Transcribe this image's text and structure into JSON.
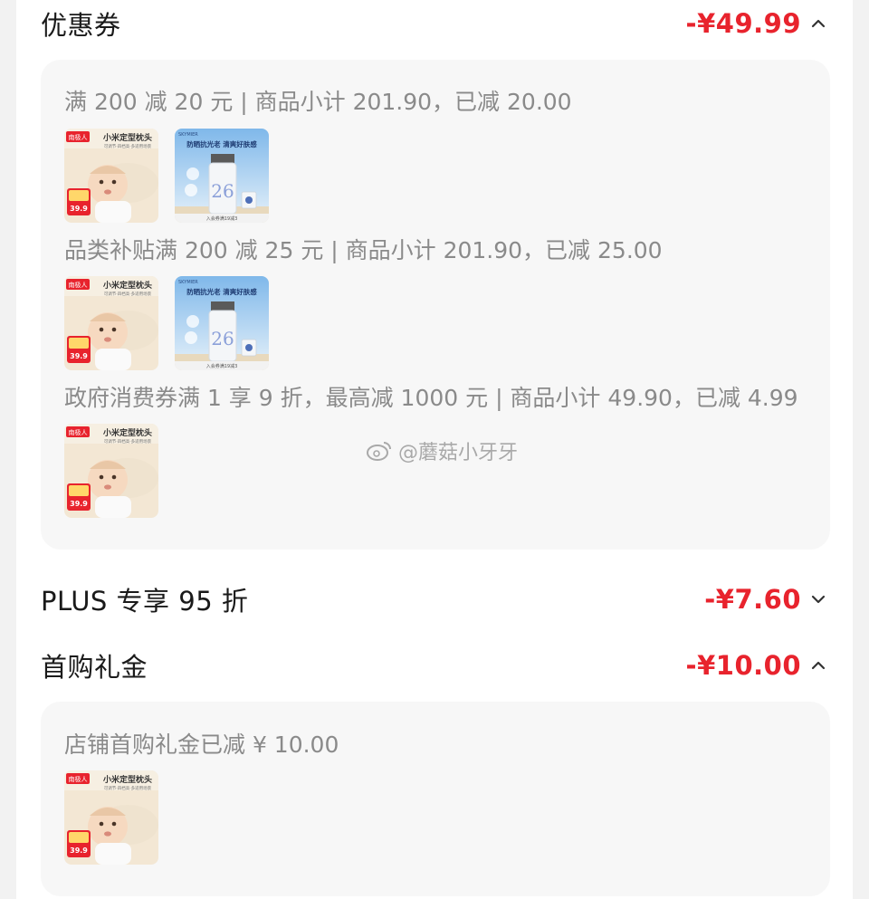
{
  "coupon": {
    "title": "优惠券",
    "amount": "-¥49.99",
    "groups": [
      {
        "text": "满 200 减 20 元 | 商品小计 201.90，已减 20.00",
        "items": [
          "baby-pillow",
          "sunscreen"
        ]
      },
      {
        "text": "品类补贴满 200 减 25 元 | 商品小计 201.90，已减 25.00",
        "items": [
          "baby-pillow",
          "sunscreen"
        ]
      },
      {
        "text": "政府消费券满 1 享 9 折，最高减 1000 元 | 商品小计 49.90，已减 4.99",
        "items": [
          "baby-pillow"
        ]
      }
    ]
  },
  "plus": {
    "title": "PLUS 专享 95 折",
    "amount": "-¥7.60"
  },
  "first_purchase": {
    "title": "首购礼金",
    "amount": "-¥10.00",
    "text": "店铺首购礼金已减 ¥ 10.00",
    "items": [
      "baby-pillow"
    ]
  },
  "products": {
    "pillow": {
      "brand": "南极人",
      "headline": "小米定型枕头",
      "sub": "可调节·四档高·多适用场景",
      "price": "39.9"
    },
    "sunscreen": {
      "brand": "SKYMIER",
      "headline": "防晒抗光老 清爽好肤感",
      "number": "26",
      "promo": "入会券满19减3"
    }
  },
  "watermark": "@蘑菇小牙牙",
  "colors": {
    "accent": "#e8232d",
    "panel": "#f7f7f7",
    "muted": "#8a8a8a"
  }
}
